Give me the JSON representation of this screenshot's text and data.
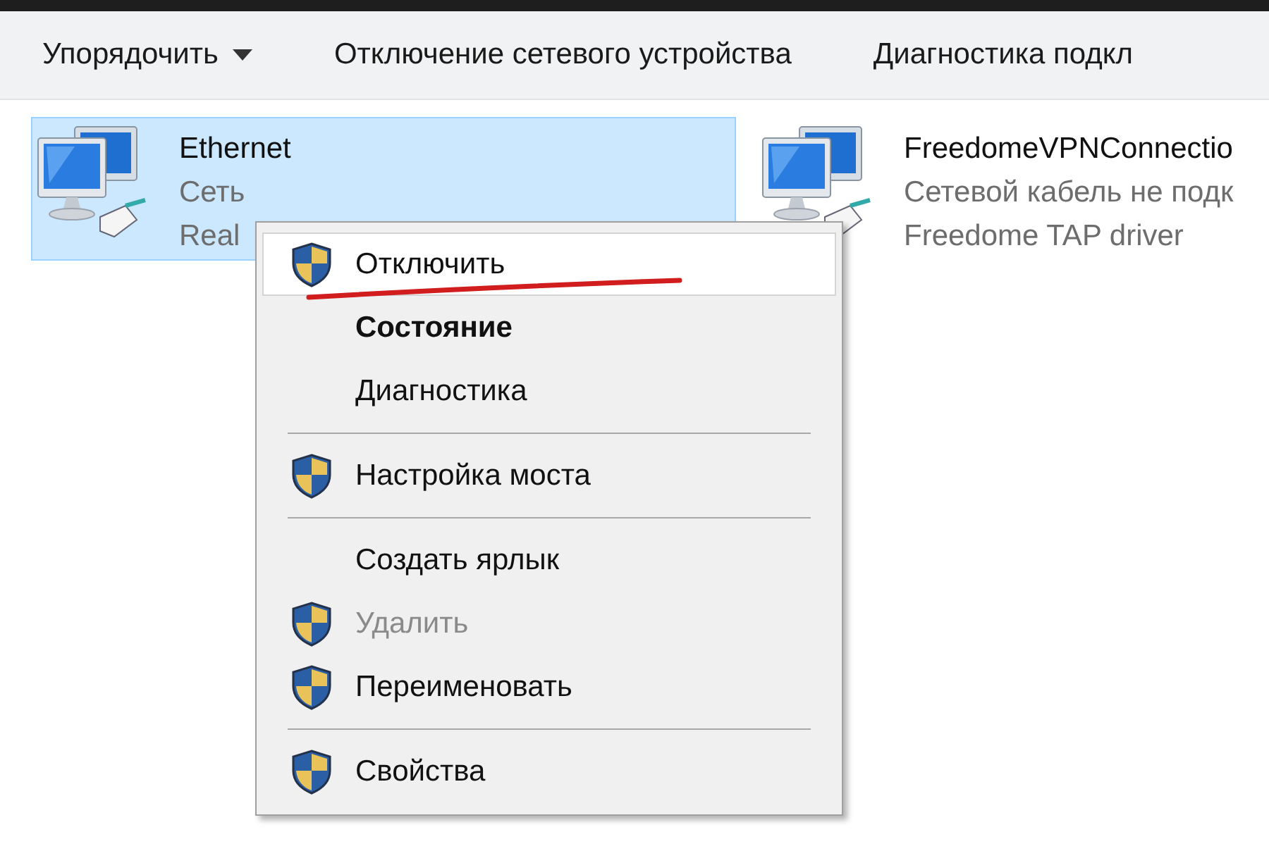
{
  "toolbar": {
    "items": [
      {
        "label": "Упорядочить",
        "dropdown": true
      },
      {
        "label": "Отключение сетевого устройства",
        "dropdown": false
      },
      {
        "label": "Диагностика подкл",
        "dropdown": false
      }
    ]
  },
  "adapters": [
    {
      "name": "Ethernet",
      "status": "Сеть",
      "device": "Real",
      "selected": true
    },
    {
      "name": "FreedomeVPNConnectio",
      "status": "Сетевой кабель не подк",
      "device": "Freedome TAP driver",
      "selected": false
    }
  ],
  "context_menu": {
    "items": [
      {
        "kind": "item",
        "label": "Отключить",
        "shield": true,
        "bold": false,
        "disabled": false,
        "selected": true,
        "underlined": true
      },
      {
        "kind": "item",
        "label": "Состояние",
        "shield": false,
        "bold": true,
        "disabled": false,
        "selected": false,
        "underlined": false
      },
      {
        "kind": "item",
        "label": "Диагностика",
        "shield": false,
        "bold": false,
        "disabled": false,
        "selected": false,
        "underlined": false
      },
      {
        "kind": "separator"
      },
      {
        "kind": "item",
        "label": "Настройка моста",
        "shield": true,
        "bold": false,
        "disabled": false,
        "selected": false,
        "underlined": false
      },
      {
        "kind": "separator"
      },
      {
        "kind": "item",
        "label": "Создать ярлык",
        "shield": false,
        "bold": false,
        "disabled": false,
        "selected": false,
        "underlined": false
      },
      {
        "kind": "item",
        "label": "Удалить",
        "shield": true,
        "bold": false,
        "disabled": true,
        "selected": false,
        "underlined": false
      },
      {
        "kind": "item",
        "label": "Переименовать",
        "shield": true,
        "bold": false,
        "disabled": false,
        "selected": false,
        "underlined": false
      },
      {
        "kind": "separator"
      },
      {
        "kind": "item",
        "label": "Свойства",
        "shield": true,
        "bold": false,
        "disabled": false,
        "selected": false,
        "underlined": false
      }
    ]
  }
}
